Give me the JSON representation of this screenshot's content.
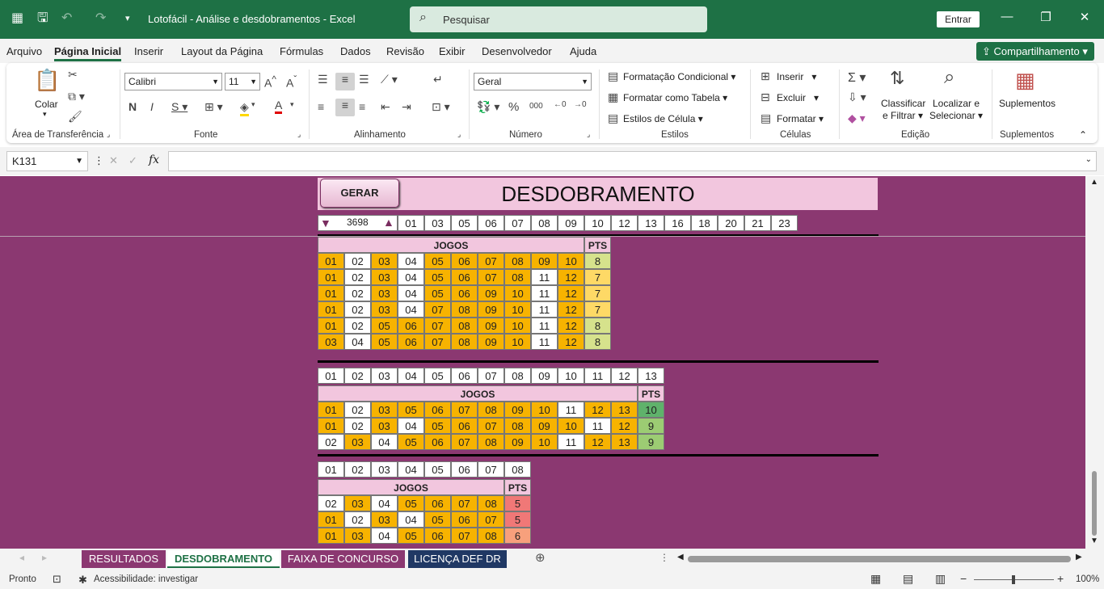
{
  "app": {
    "title": "Lotofácil - Análise e desdobramentos  -  Excel",
    "search_placeholder": "Pesquisar",
    "signin": "Entrar"
  },
  "menu": [
    "Arquivo",
    "Página Inicial",
    "Inserir",
    "Layout da Página",
    "Fórmulas",
    "Dados",
    "Revisão",
    "Exibir",
    "Desenvolvedor",
    "Ajuda"
  ],
  "share": "Compartilhamento",
  "ribbon": {
    "paste": "Colar",
    "font_name": "Calibri",
    "font_size": "11",
    "number_format": "Geral",
    "cond_format": "Formatação Condicional",
    "format_table": "Formatar como Tabela",
    "cell_styles": "Estilos de Célula",
    "insert": "Inserir",
    "delete": "Excluir",
    "format": "Formatar",
    "sort": "Classificar",
    "sort2": "e Filtrar",
    "find": "Localizar e",
    "find2": "Selecionar",
    "addins": "Suplementos",
    "groups": [
      "Área de Transferência",
      "Fonte",
      "Alinhamento",
      "Número",
      "Estilos",
      "Células",
      "Edição",
      "Suplementos"
    ]
  },
  "formula_bar": {
    "name_box": "K131",
    "fx": "fx",
    "formula": ""
  },
  "sheet": {
    "button": "GERAR",
    "title": "DESDOBRAMENTO",
    "counter": "3698",
    "chosen": [
      "01",
      "03",
      "05",
      "06",
      "07",
      "08",
      "09",
      "10",
      "12",
      "13",
      "16",
      "18",
      "20",
      "21",
      "23"
    ],
    "jogos_label": "JOGOS",
    "pts_label": "PTS",
    "block1": {
      "rows": [
        {
          "nums": [
            "01",
            "02",
            "03",
            "04",
            "05",
            "06",
            "07",
            "08",
            "09",
            "10"
          ],
          "pts": "8"
        },
        {
          "nums": [
            "01",
            "02",
            "03",
            "04",
            "05",
            "06",
            "07",
            "08",
            "11",
            "12"
          ],
          "pts": "7"
        },
        {
          "nums": [
            "01",
            "02",
            "03",
            "04",
            "05",
            "06",
            "09",
            "10",
            "11",
            "12"
          ],
          "pts": "7"
        },
        {
          "nums": [
            "01",
            "02",
            "03",
            "04",
            "07",
            "08",
            "09",
            "10",
            "11",
            "12"
          ],
          "pts": "7"
        },
        {
          "nums": [
            "01",
            "02",
            "05",
            "06",
            "07",
            "08",
            "09",
            "10",
            "11",
            "12"
          ],
          "pts": "8"
        },
        {
          "nums": [
            "03",
            "04",
            "05",
            "06",
            "07",
            "08",
            "09",
            "10",
            "11",
            "12"
          ],
          "pts": "8"
        }
      ]
    },
    "block2": {
      "header": [
        "01",
        "02",
        "03",
        "04",
        "05",
        "06",
        "07",
        "08",
        "09",
        "10",
        "11",
        "12",
        "13"
      ],
      "rows": [
        {
          "nums": [
            "01",
            "02",
            "03",
            "05",
            "06",
            "07",
            "08",
            "09",
            "10",
            "11",
            "12",
            "13"
          ],
          "pts": "10"
        },
        {
          "nums": [
            "01",
            "02",
            "03",
            "04",
            "05",
            "06",
            "07",
            "08",
            "09",
            "10",
            "11",
            "12"
          ],
          "pts": "9"
        },
        {
          "nums": [
            "02",
            "03",
            "04",
            "05",
            "06",
            "07",
            "08",
            "09",
            "10",
            "11",
            "12",
            "13"
          ],
          "pts": "9"
        }
      ]
    },
    "block3": {
      "header": [
        "01",
        "02",
        "03",
        "04",
        "05",
        "06",
        "07",
        "08"
      ],
      "rows": [
        {
          "nums": [
            "02",
            "03",
            "04",
            "05",
            "06",
            "07",
            "08"
          ],
          "pts": "5"
        },
        {
          "nums": [
            "01",
            "02",
            "03",
            "04",
            "05",
            "06",
            "07"
          ],
          "pts": "5"
        },
        {
          "nums": [
            "01",
            "03",
            "04",
            "05",
            "06",
            "07",
            "08"
          ],
          "pts": "6"
        }
      ]
    }
  },
  "tabs": [
    {
      "label": "RESULTADOS",
      "color": "#8b3871"
    },
    {
      "label": "DESDOBRAMENTO",
      "color": "#ffffff",
      "active": true
    },
    {
      "label": "FAIXA DE CONCURSO",
      "color": "#8b3871"
    },
    {
      "label": "LICENÇA DEF DR",
      "color": "#203864"
    }
  ],
  "status": {
    "ready": "Pronto",
    "accessibility": "Acessibilidade: investigar",
    "zoom": "100%"
  }
}
